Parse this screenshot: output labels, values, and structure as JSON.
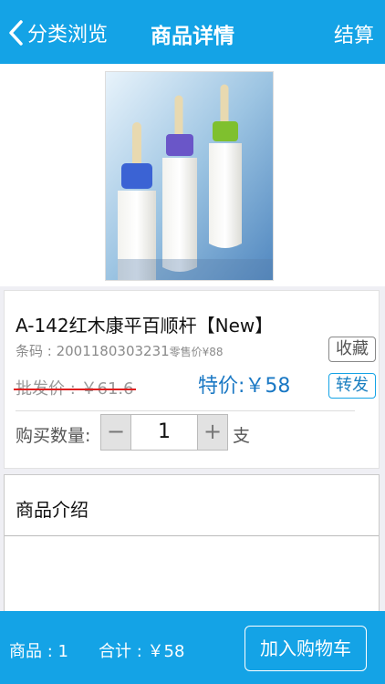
{
  "header": {
    "back_label": "分类浏览",
    "title": "商品详情",
    "checkout_label": "结算",
    "color": "#14a3e6"
  },
  "product": {
    "image_icon": "baby-bottles-photo",
    "name": "A-142红木康平百顺杆【New】",
    "barcode": "条码 : 2001180303231",
    "retail_price": "零售价¥88",
    "wholesale_price": "批发价 : ￥61.6",
    "special_price": "特价:￥58",
    "favorite_label": "收藏",
    "share_label": "转发",
    "quantity_label": "购买数量:",
    "quantity_minus": "−",
    "quantity_value": "1",
    "quantity_plus": "+",
    "unit": "支"
  },
  "description": {
    "title": "商品介绍"
  },
  "footer": {
    "count": "商品 : 1",
    "total": "合计 : ￥58",
    "add_to_cart": "加入购物车"
  }
}
